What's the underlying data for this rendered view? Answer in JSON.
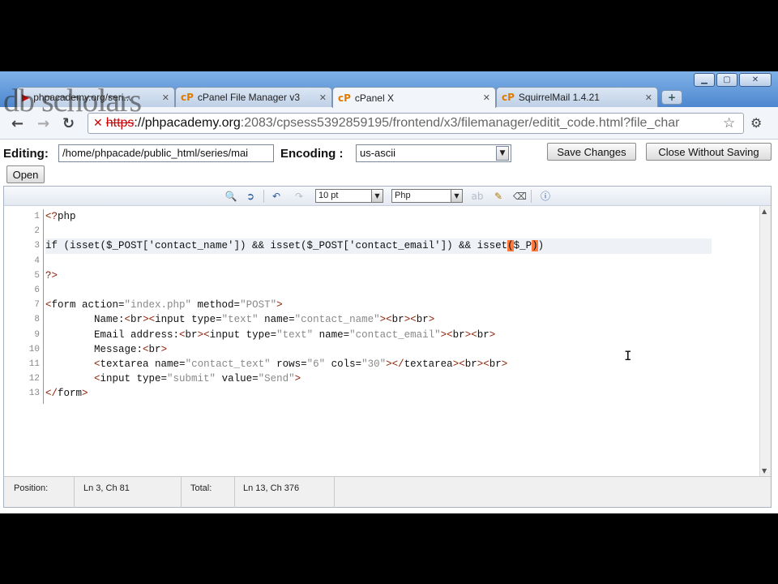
{
  "watermark": "db scholars",
  "window_controls": {
    "minimize": "▁",
    "maximize": "▢",
    "close": "✕"
  },
  "tabs": [
    {
      "label": "phpacademy.org/seri...",
      "favicon": "youtube-icon",
      "glyph": "▶",
      "active": false
    },
    {
      "label": "cPanel File Manager v3",
      "favicon": "cpanel-icon",
      "glyph": "cP",
      "active": false
    },
    {
      "label": "cPanel X",
      "favicon": "cpanel-icon",
      "glyph": "cP",
      "active": true
    },
    {
      "label": "SquirrelMail 1.4.21",
      "favicon": "cpanel-icon",
      "glyph": "cP",
      "active": false
    }
  ],
  "tab_close_glyph": "✕",
  "new_tab_glyph": "+",
  "address": {
    "scheme": "https",
    "host": "://phpacademy.org",
    "path": ":2083/cpsess5392859195/frontend/x3/filemanager/editit_code.html?file_char"
  },
  "nav": {
    "back": "←",
    "forward": "→",
    "reload": "↻",
    "star": "☆",
    "wrench": "🔧"
  },
  "editor_header": {
    "editing_label": "Editing:",
    "file_path": "/home/phpacade/public_html/series/mai",
    "encoding_label": "Encoding :",
    "encoding_value": "us-ascii",
    "save_button": "Save Changes",
    "close_button": "Close Without Saving",
    "open_button": "Open"
  },
  "editor_toolbar": {
    "font_size": "10 pt",
    "syntax": "Php"
  },
  "code": {
    "line_numbers": [
      "1",
      "2",
      "3",
      "4",
      "5",
      "6",
      "7",
      "8",
      "9",
      "10",
      "11",
      "12",
      "13"
    ],
    "active_line": 3
  },
  "status": {
    "position_label": "Position:",
    "position_value": "Ln 3, Ch 81",
    "total_label": "Total:",
    "total_value": "Ln 13, Ch 376"
  }
}
